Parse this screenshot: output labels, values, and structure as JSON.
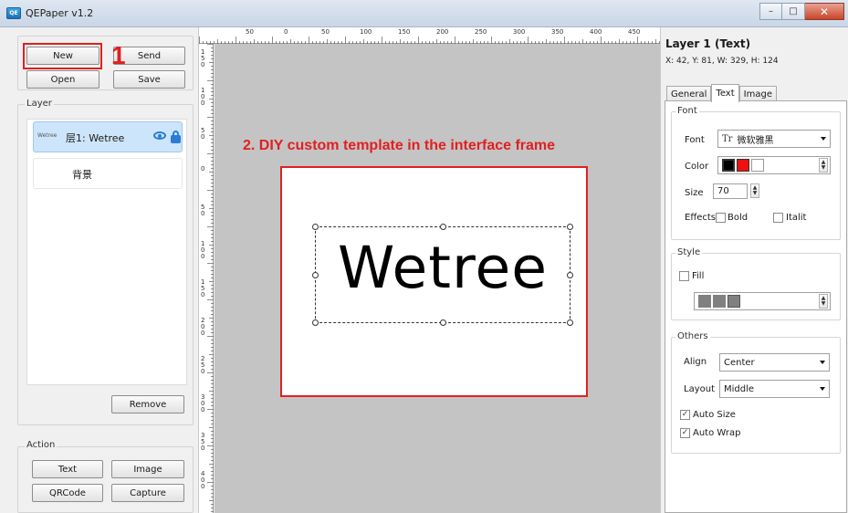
{
  "window": {
    "title": "QEPaper v1.2",
    "app_icon_text": "QE"
  },
  "left_panel": {
    "buttons": {
      "new": "New",
      "send": "Send",
      "open": "Open",
      "save": "Save",
      "remove": "Remove"
    },
    "layer_group_label": "Layer",
    "layers": [
      {
        "thumb": "Wetree",
        "name": "层1: Wetree",
        "selected": true
      },
      {
        "name": "背景",
        "selected": false
      }
    ],
    "action_group_label": "Action",
    "action_buttons": {
      "text": "Text",
      "image": "Image",
      "qrcode": "QRCode",
      "capture": "Capture"
    }
  },
  "rulers": {
    "top_labels": [
      "50",
      "0",
      "50",
      "100",
      "150",
      "200",
      "250",
      "300",
      "350",
      "400",
      "450"
    ],
    "left_labels": [
      "1\n5\n0",
      "1\n0\n0",
      "5\n0",
      "0",
      "5\n0",
      "1\n0\n0",
      "1\n5\n0",
      "2\n0\n0",
      "2\n5\n0",
      "3\n0\n0",
      "3\n5\n0",
      "4\n0\n0"
    ]
  },
  "canvas": {
    "text": "Wetree"
  },
  "annotations": {
    "step_one": "1",
    "step_two": "2. DIY custom template in the interface frame"
  },
  "properties": {
    "title": "Layer 1 (Text)",
    "coords": "X: 42, Y: 81, W: 329, H: 124",
    "tabs": [
      "General",
      "Text",
      "Image"
    ],
    "font_group": "Font",
    "font_label": "Font",
    "font_value": "微软雅黑",
    "font_icon": "Tr",
    "color_label": "Color",
    "colors": [
      "#000000",
      "#ee1111",
      "#ffffff"
    ],
    "size_label": "Size",
    "size_value": "70",
    "effects_label": "Effects",
    "bold_label": "Bold",
    "italic_label": "Italit",
    "style_group": "Style",
    "fill_label": "Fill",
    "fill_colors": [
      "#808080",
      "#808080",
      "#808080"
    ],
    "others_group": "Others",
    "align_label": "Align",
    "align_value": "Center",
    "layout_label": "Layout",
    "layout_value": "Middle",
    "auto_size_label": "Auto Size",
    "auto_wrap_label": "Auto Wrap"
  }
}
